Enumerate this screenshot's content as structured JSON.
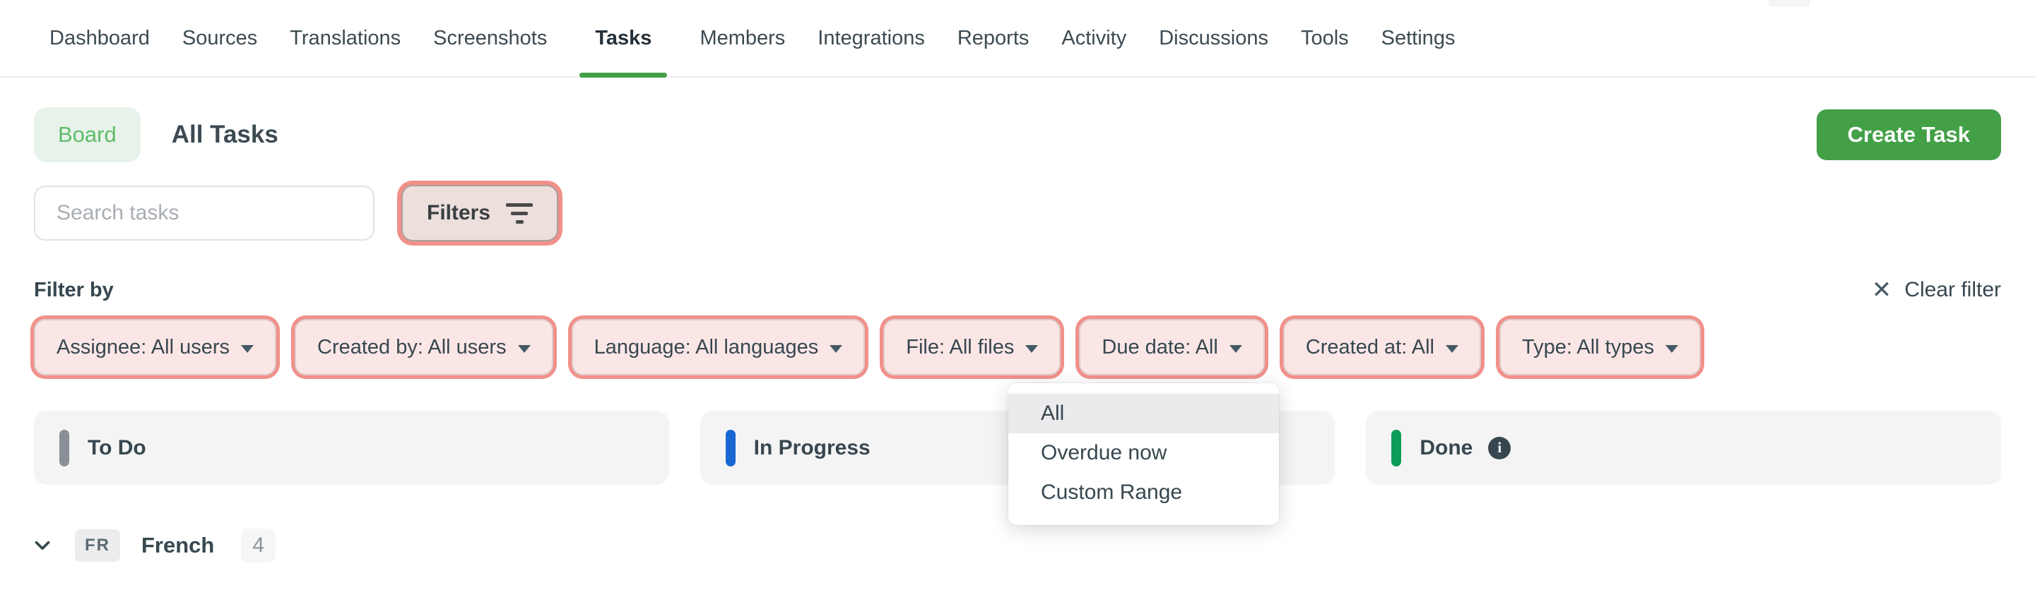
{
  "nav": {
    "items": [
      {
        "label": "Dashboard",
        "active": false
      },
      {
        "label": "Sources",
        "active": false
      },
      {
        "label": "Translations",
        "active": false
      },
      {
        "label": "Screenshots",
        "active": false
      },
      {
        "label": "Tasks",
        "active": true
      },
      {
        "label": "Members",
        "active": false
      },
      {
        "label": "Integrations",
        "active": false
      },
      {
        "label": "Reports",
        "active": false
      },
      {
        "label": "Activity",
        "active": false
      },
      {
        "label": "Discussions",
        "active": false
      },
      {
        "label": "Tools",
        "active": false
      },
      {
        "label": "Settings",
        "active": false
      }
    ]
  },
  "header": {
    "board_label": "Board",
    "title": "All Tasks",
    "create_task_label": "Create Task"
  },
  "toolbar": {
    "search_placeholder": "Search tasks",
    "filters_label": "Filters"
  },
  "filter_bar": {
    "label": "Filter by",
    "clear_label": "Clear filter",
    "clear_icon": "✕",
    "chips": [
      {
        "label": "Assignee: All users"
      },
      {
        "label": "Created by: All users"
      },
      {
        "label": "Language: All languages"
      },
      {
        "label": "File: All files"
      },
      {
        "label": "Due date: All"
      },
      {
        "label": "Created at: All"
      },
      {
        "label": "Type: All types"
      }
    ]
  },
  "dropdown": {
    "attached_to": "Due date: All",
    "options": [
      {
        "label": "All",
        "selected": true
      },
      {
        "label": "Overdue now",
        "selected": false
      },
      {
        "label": "Custom Range",
        "selected": false
      }
    ]
  },
  "board": {
    "columns": [
      {
        "label": "To Do",
        "status_color": "#8a9098",
        "has_info": false
      },
      {
        "label": "In Progress",
        "status_color": "#1967d2",
        "has_info": false
      },
      {
        "label": "Done",
        "status_color": "#0b9d58",
        "has_info": true,
        "info_glyph": "i"
      }
    ]
  },
  "group_row": {
    "lang_code": "FR",
    "lang_name": "French",
    "count": "4"
  },
  "colors": {
    "accent_green": "#43a047",
    "board_chip_bg": "#e7f3ea",
    "board_chip_text": "#5fba69",
    "highlight_ring": "#f1908a",
    "highlight_fill": "#fbe6e6",
    "column_bg": "#f4f4f5",
    "dropdown_selected_bg": "#ebebed"
  }
}
